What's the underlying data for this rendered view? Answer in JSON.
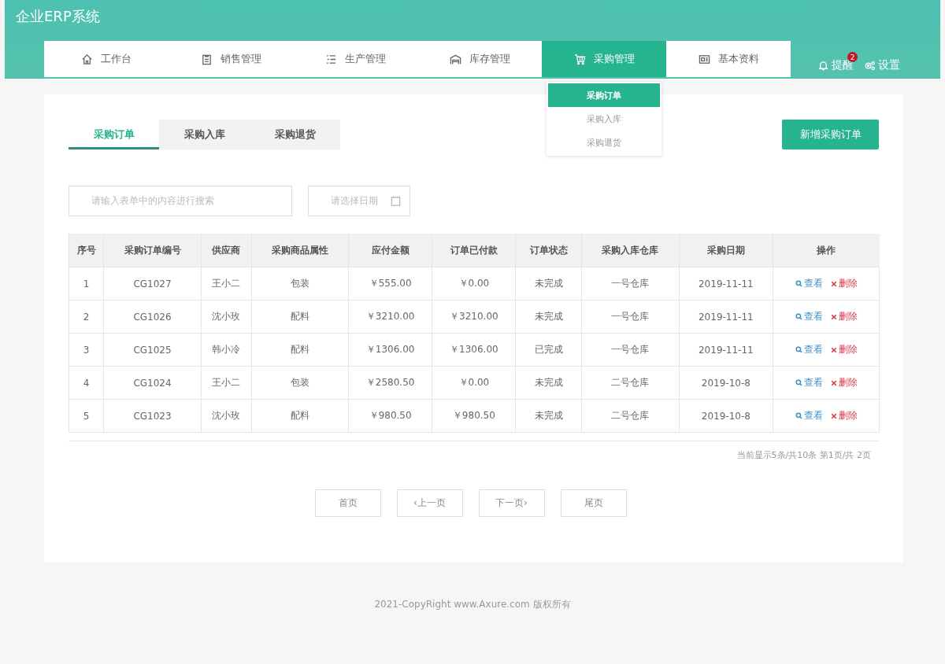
{
  "app_title": "企业ERP系统",
  "nav": [
    {
      "label": "工作台",
      "selected": false
    },
    {
      "label": "销售管理",
      "selected": false
    },
    {
      "label": "生产管理",
      "selected": false
    },
    {
      "label": "库存管理",
      "selected": false
    },
    {
      "label": "采购管理",
      "selected": true,
      "dropdown": [
        {
          "label": "采购订单",
          "selected": true
        },
        {
          "label": "采购入库",
          "selected": false
        },
        {
          "label": "采购退货",
          "selected": false
        }
      ]
    },
    {
      "label": "基本资料",
      "selected": false
    }
  ],
  "header_actions": [
    {
      "label": "提醒",
      "badge": "2"
    },
    {
      "label": "设置"
    }
  ],
  "tabs": [
    {
      "label": "采购订单",
      "selected": true
    },
    {
      "label": "采购入库",
      "selected": false
    },
    {
      "label": "采购退货",
      "selected": false
    }
  ],
  "new_button": "新增采购订单",
  "search": {
    "placeholder": "请输入表单中的内容进行搜索"
  },
  "date": {
    "placeholder": "请选择日期"
  },
  "table": {
    "columns": [
      "序号",
      "采购订单编号",
      "供应商",
      "采购商品属性",
      "应付金额",
      "订单已付款",
      "订单状态",
      "采购入库仓库",
      "采购日期",
      "操作"
    ],
    "rows": [
      {
        "cells": [
          "1",
          "CG1027",
          "王小二",
          "包装",
          "￥555.00",
          "￥0.00",
          "未完成",
          "一号仓库",
          "2019-11-11"
        ],
        "actions": [
          "查看",
          "删除"
        ]
      },
      {
        "cells": [
          "2",
          "CG1026",
          "沈小玫",
          "配料",
          "￥3210.00",
          "￥3210.00",
          "未完成",
          "一号仓库",
          "2019-11-11"
        ],
        "actions": [
          "查看",
          "删除"
        ]
      },
      {
        "cells": [
          "3",
          "CG1025",
          "韩小冷",
          "配料",
          "￥1306.00",
          "￥1306.00",
          "已完成",
          "一号仓库",
          "2019-11-11"
        ],
        "actions": [
          "查看",
          "删除"
        ]
      },
      {
        "cells": [
          "4",
          "CG1024",
          "王小二",
          "包装",
          "￥2580.50",
          "￥0.00",
          "未完成",
          "二号仓库",
          "2019-10-8"
        ],
        "actions": [
          "查看",
          "删除"
        ]
      },
      {
        "cells": [
          "5",
          "CG1023",
          "沈小玫",
          "配料",
          "￥980.50",
          "￥980.50",
          "未完成",
          "二号仓库",
          "2019-10-8"
        ],
        "actions": [
          "查看",
          "删除"
        ]
      }
    ]
  },
  "page_info": "当前显示5条/共10条 第1页/共 2页",
  "pagination": [
    "首页",
    "‹上一页",
    "下一页›",
    "尾页"
  ],
  "footer": "2021-CopyRight www.Axure.com 版权所有"
}
